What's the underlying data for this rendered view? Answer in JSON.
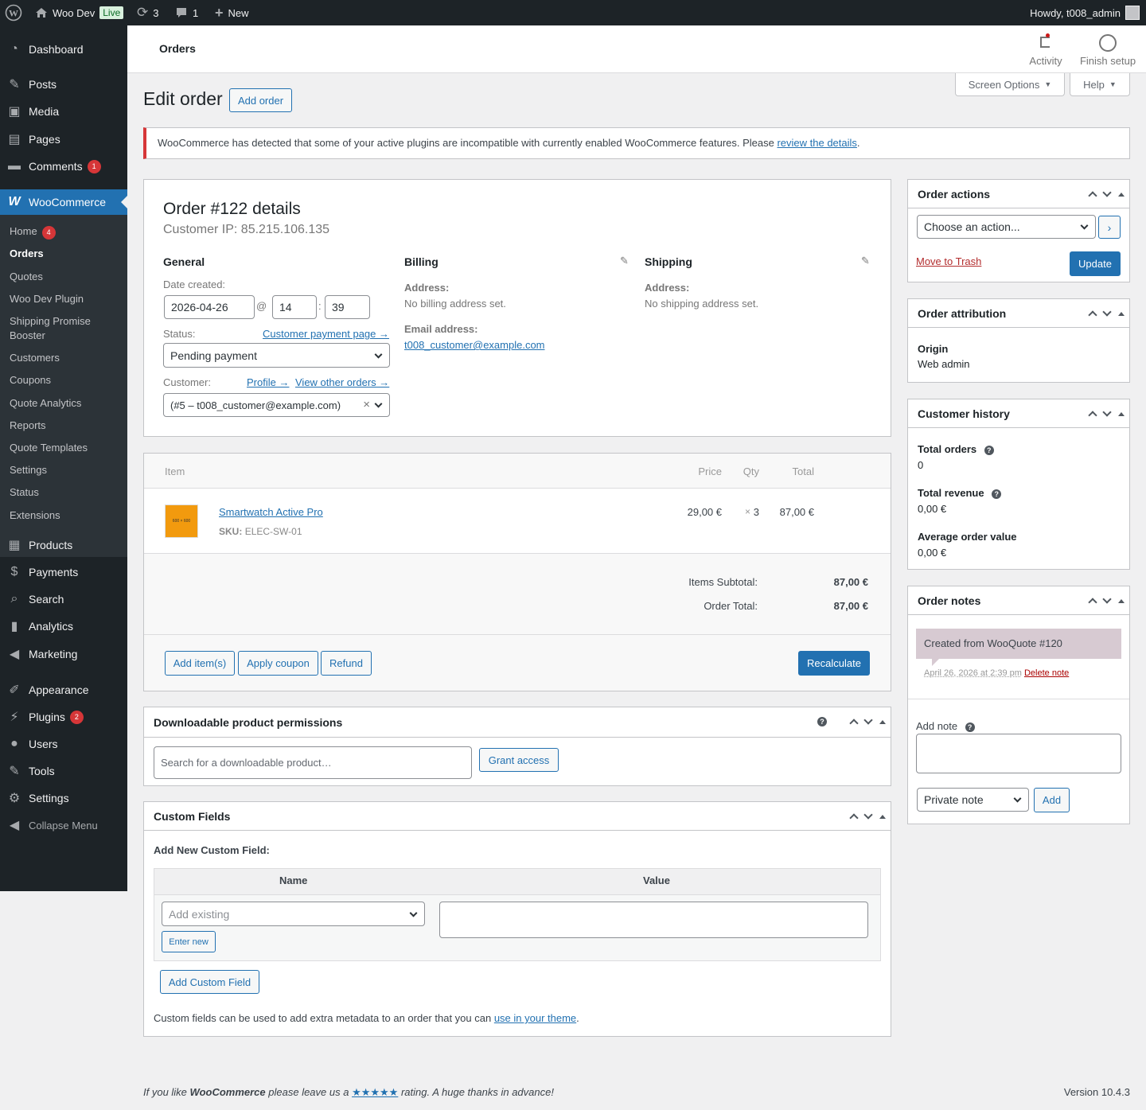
{
  "adminbar": {
    "site_name": "Woo Dev",
    "live_badge": "Live",
    "updates_count": "3",
    "comments_count": "1",
    "new_label": "New",
    "howdy": "Howdy, t008_admin"
  },
  "sidebar": {
    "dashboard": "Dashboard",
    "posts": "Posts",
    "media": "Media",
    "pages": "Pages",
    "comments": "Comments",
    "comments_badge": "1",
    "woocommerce": "WooCommerce",
    "woo_sub": {
      "home": "Home",
      "home_badge": "4",
      "orders": "Orders",
      "quotes": "Quotes",
      "woo_dev_plugin": "Woo Dev Plugin",
      "shipping_promise": "Shipping Promise Booster",
      "customers": "Customers",
      "coupons": "Coupons",
      "quote_analytics": "Quote Analytics",
      "reports": "Reports",
      "quote_templates": "Quote Templates",
      "settings": "Settings",
      "status": "Status",
      "extensions": "Extensions"
    },
    "products": "Products",
    "payments": "Payments",
    "search": "Search",
    "analytics": "Analytics",
    "marketing": "Marketing",
    "appearance": "Appearance",
    "plugins": "Plugins",
    "plugins_badge": "2",
    "users": "Users",
    "tools": "Tools",
    "settings": "Settings",
    "collapse": "Collapse Menu"
  },
  "header": {
    "title": "Orders",
    "activity": "Activity",
    "finish_setup": "Finish setup"
  },
  "page": {
    "title": "Edit order",
    "add_order": "Add order",
    "screen_options": "Screen Options",
    "help": "Help"
  },
  "notice": {
    "text": "WooCommerce has detected that some of your active plugins are incompatible with currently enabled WooCommerce features. Please ",
    "link": "review the details",
    "end": "."
  },
  "order": {
    "heading": "Order #122 details",
    "customer_ip": "Customer IP: 85.215.106.135",
    "general": "General",
    "date_created_label": "Date created:",
    "date": "2026-04-26",
    "at": "@",
    "hour": "14",
    "colon": ":",
    "minute": "39",
    "status_label": "Status:",
    "customer_payment_page": "Customer payment page →",
    "status_value": "Pending payment",
    "customer_label": "Customer:",
    "profile_link": "Profile →",
    "view_other_orders": "View other orders →",
    "customer_value": "(#5 – t008_customer@example.com)",
    "clear_x": "×",
    "billing": "Billing",
    "billing_address_label": "Address:",
    "billing_address": "No billing address set.",
    "email_label": "Email address:",
    "email": "t008_customer@example.com",
    "shipping": "Shipping",
    "shipping_address_label": "Address:",
    "shipping_address": "No shipping address set."
  },
  "items": {
    "col_item": "Item",
    "col_price": "Price",
    "col_qty": "Qty",
    "col_total": "Total",
    "thumb_text": "600 × 600",
    "product_name": "Smartwatch Active Pro",
    "sku_label": "SKU:",
    "sku": "ELEC-SW-01",
    "price": "29,00 €",
    "qty_x": "×",
    "qty": "3",
    "total": "87,00 €",
    "subtotal_label": "Items Subtotal:",
    "subtotal": "87,00 €",
    "order_total_label": "Order Total:",
    "order_total": "87,00 €",
    "add_items": "Add item(s)",
    "apply_coupon": "Apply coupon",
    "refund": "Refund",
    "recalculate": "Recalculate"
  },
  "downloads": {
    "title": "Downloadable product permissions",
    "search_placeholder": "Search for a downloadable product…",
    "grant_access": "Grant access"
  },
  "custom_fields": {
    "title": "Custom Fields",
    "add_new": "Add New Custom Field:",
    "col_name": "Name",
    "col_value": "Value",
    "add_existing": "Add existing",
    "enter_new": "Enter new",
    "add_button": "Add Custom Field",
    "desc": "Custom fields can be used to add extra metadata to an order that you can ",
    "desc_link": "use in your theme",
    "desc_end": "."
  },
  "order_actions": {
    "title": "Order actions",
    "choose": "Choose an action...",
    "move_trash": "Move to Trash",
    "update": "Update"
  },
  "attribution": {
    "title": "Order attribution",
    "origin_label": "Origin",
    "origin": "Web admin"
  },
  "history": {
    "title": "Customer history",
    "total_orders_label": "Total orders",
    "total_orders": "0",
    "total_revenue_label": "Total revenue",
    "total_revenue": "0,00 €",
    "aov_label": "Average order value",
    "aov": "0,00 €"
  },
  "notes": {
    "title": "Order notes",
    "note_text": "Created from WooQuote #120",
    "note_date": "April 26, 2026 at 2:39 pm",
    "delete_note": "Delete note",
    "add_note_label": "Add note",
    "note_type": "Private note",
    "add": "Add"
  },
  "footer": {
    "text1": "If you like ",
    "brand": "WooCommerce",
    "text2": " please leave us a ",
    "stars": "★★★★★",
    "text3": " rating. A huge thanks in advance!",
    "version": "Version 10.4.3"
  }
}
